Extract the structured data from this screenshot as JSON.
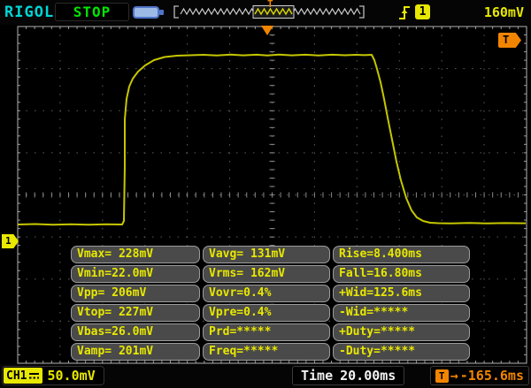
{
  "brand": {
    "logo": "RIGOL"
  },
  "top_bar": {
    "run_state": "STOP",
    "usb_icon": "usb-device",
    "memory_bar_trigger_marker": "T",
    "trigger_edge_icon": "rising-edge",
    "trigger_source": "1",
    "trigger_level": "160mV"
  },
  "screen": {
    "trigger_level_tag": "T",
    "channel_marker": "1"
  },
  "measurements": {
    "rows": [
      [
        "Vmax= 228mV",
        "Vavg= 131mV",
        "Rise=8.400ms"
      ],
      [
        "Vmin=22.0mV",
        "Vrms= 162mV",
        "Fall=16.80ms"
      ],
      [
        "Vpp= 206mV",
        "Vovr=0.4%",
        "+Wid=125.6ms"
      ],
      [
        "Vtop= 227mV",
        "Vpre=0.4%",
        "-Wid=*****"
      ],
      [
        "Vbas=26.0mV",
        "Prd=*****",
        "+Duty=*****"
      ],
      [
        "Vamp= 201mV",
        "Freq=*****",
        "-Duty=*****"
      ]
    ]
  },
  "bottom_bar": {
    "channel_label": "CH1",
    "coupling": "DC",
    "vertical_scale": "50.0mV",
    "time_label": "Time",
    "time_value": "20.00ms",
    "offset_icon": "T",
    "offset_arrow": "→",
    "offset_value": "-165.6ms"
  },
  "grid": {
    "h_divisions": 12,
    "v_divisions": 8
  },
  "colors": {
    "trace": "#c6c600",
    "accent_yellow": "#e8e800",
    "orange": "#f28500",
    "green": "#00e600",
    "cyan": "#00d6d6",
    "panel_bg": "#4a4a4a",
    "grid_line": "#5e5e5e",
    "border": "#b5b5b5"
  },
  "waveform": {
    "color": "#c6c600",
    "points": [
      [
        20,
        226
      ],
      [
        40,
        225.5
      ],
      [
        60,
        226.3
      ],
      [
        80,
        225.7
      ],
      [
        100,
        226.2
      ],
      [
        120,
        225.8
      ],
      [
        138,
        226
      ],
      [
        140,
        222
      ],
      [
        141,
        160
      ],
      [
        141,
        107
      ],
      [
        143,
        84
      ],
      [
        146,
        70
      ],
      [
        150,
        61
      ],
      [
        156,
        53
      ],
      [
        164,
        46
      ],
      [
        174,
        40
      ],
      [
        186,
        36.5
      ],
      [
        200,
        35
      ],
      [
        215,
        34.5
      ],
      [
        230,
        34
      ],
      [
        245,
        34.8
      ],
      [
        260,
        33.8
      ],
      [
        275,
        34.6
      ],
      [
        290,
        33.9
      ],
      [
        302,
        34.7
      ],
      [
        315,
        33.8
      ],
      [
        330,
        34.6
      ],
      [
        345,
        33.9
      ],
      [
        360,
        34.7
      ],
      [
        375,
        33.9
      ],
      [
        390,
        34.5
      ],
      [
        402,
        34
      ],
      [
        412,
        34.4
      ],
      [
        420,
        34
      ],
      [
        423,
        40
      ],
      [
        426,
        50
      ],
      [
        430,
        65
      ],
      [
        434,
        84
      ],
      [
        438,
        105
      ],
      [
        443,
        130
      ],
      [
        448,
        155
      ],
      [
        453,
        176
      ],
      [
        459,
        196
      ],
      [
        465,
        210
      ],
      [
        471,
        218
      ],
      [
        478,
        222
      ],
      [
        486,
        224
      ],
      [
        495,
        224.5
      ],
      [
        510,
        224.8
      ],
      [
        530,
        224.3
      ],
      [
        550,
        224.8
      ],
      [
        570,
        224.4
      ],
      [
        594,
        224.6
      ]
    ]
  }
}
